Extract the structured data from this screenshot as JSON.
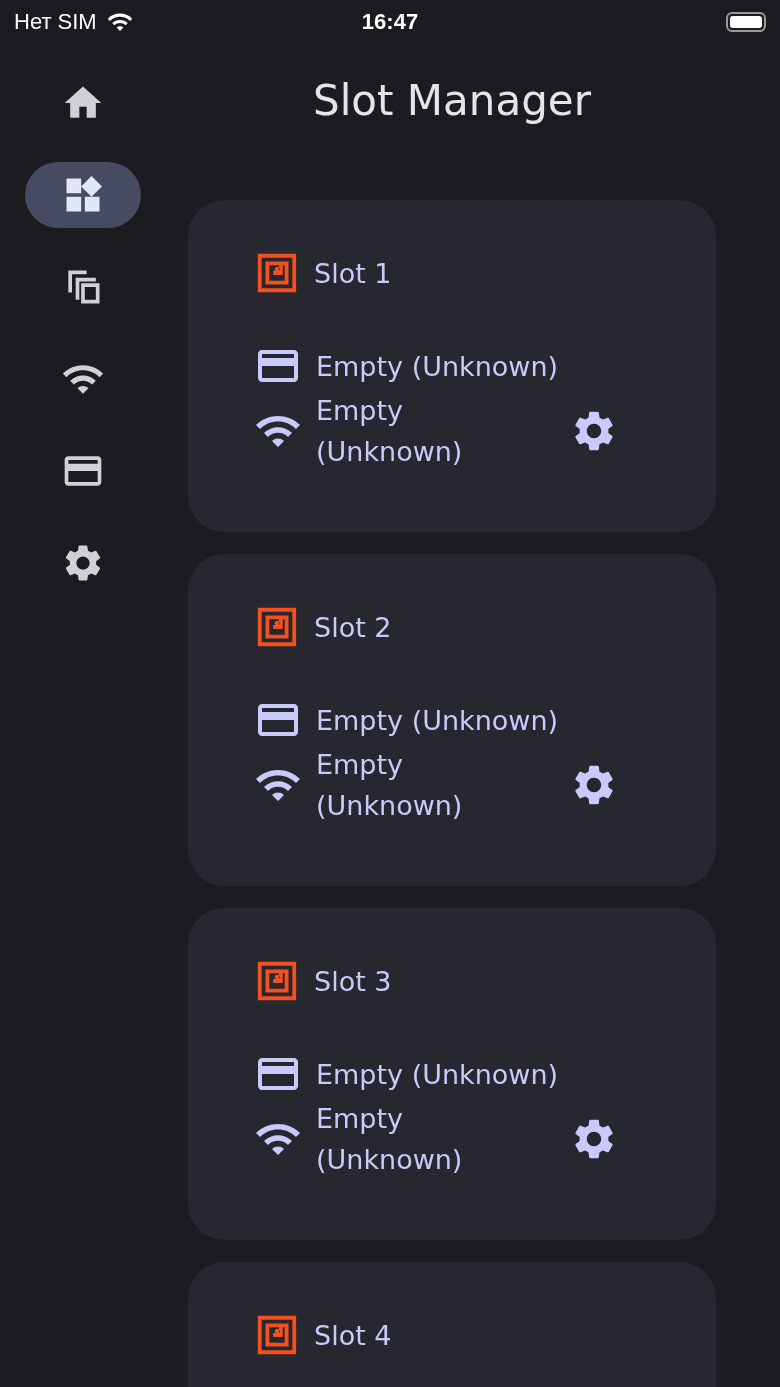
{
  "status_bar": {
    "carrier": "Нет SIM",
    "time": "16:47"
  },
  "nav": [
    {
      "kind": "home",
      "selected": false
    },
    {
      "kind": "widgets",
      "selected": true
    },
    {
      "kind": "copy",
      "selected": false
    },
    {
      "kind": "wifi",
      "selected": false
    },
    {
      "kind": "card",
      "selected": false
    },
    {
      "kind": "settings",
      "selected": false
    }
  ],
  "title": "Slot Manager",
  "slots": [
    {
      "name": "Slot 1",
      "card_status": "Empty (Unknown)",
      "wifi_status": "Empty (Unknown)"
    },
    {
      "name": "Slot 2",
      "card_status": "Empty (Unknown)",
      "wifi_status": "Empty (Unknown)"
    },
    {
      "name": "Slot 3",
      "card_status": "Empty (Unknown)",
      "wifi_status": "Empty (Unknown)"
    },
    {
      "name": "Slot 4"
    }
  ]
}
